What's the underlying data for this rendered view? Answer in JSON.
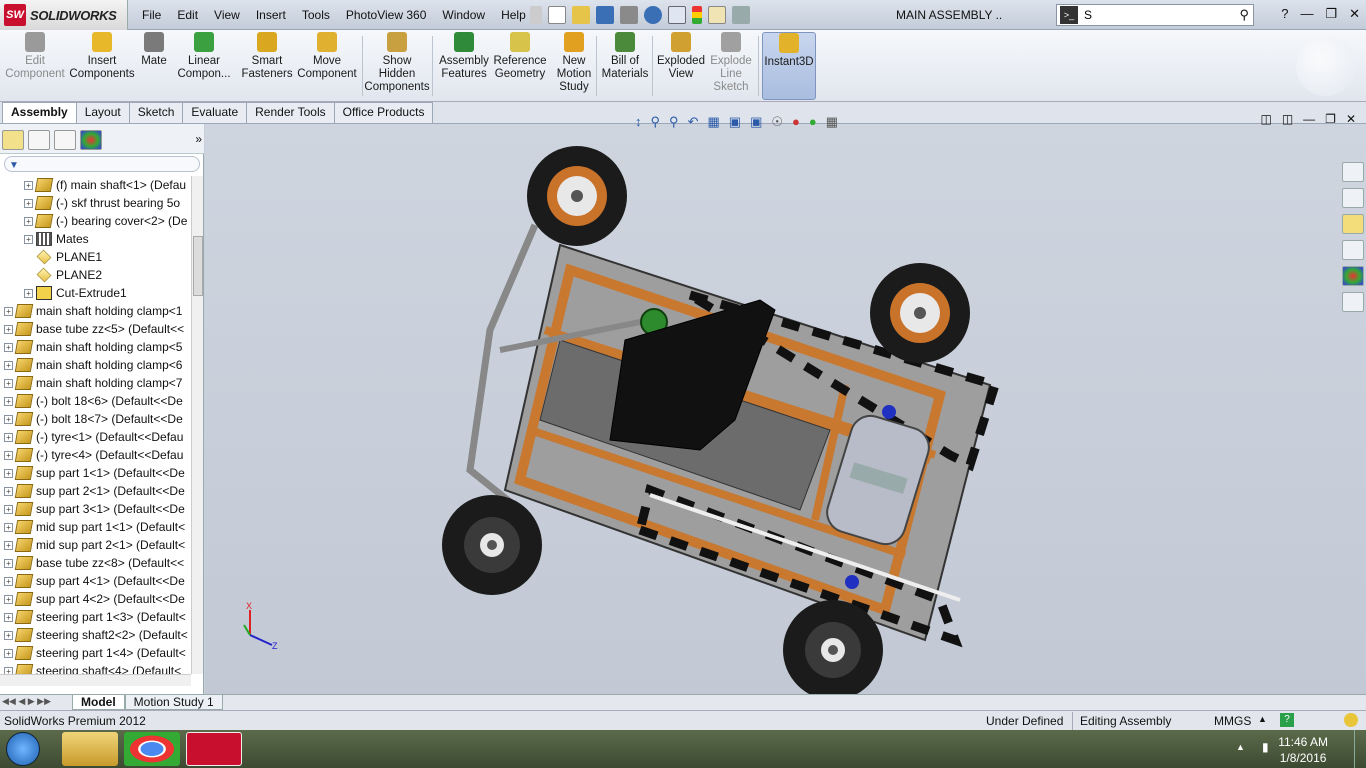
{
  "app": {
    "brand": "SOLIDWORKS",
    "brand_badge": "SW"
  },
  "menu": [
    "File",
    "Edit",
    "View",
    "Insert",
    "Tools",
    "PhotoView 360",
    "Window",
    "Help"
  ],
  "document_title": "MAIN ASSEMBLY ..",
  "search": {
    "value": "S",
    "cmd_icon": "command-prompt-icon"
  },
  "toolbar": [
    {
      "label": "Edit\nComponent",
      "icon": "edit-component-icon",
      "enabled": false,
      "color": "#9a9a9a"
    },
    {
      "label": "Insert\nComponents",
      "icon": "insert-components-icon",
      "enabled": true,
      "color": "#e6b82a"
    },
    {
      "label": "Mate",
      "icon": "mate-icon",
      "enabled": true,
      "color": "#7a7a7a"
    },
    {
      "label": "Linear\nCompon...",
      "icon": "linear-pattern-icon",
      "enabled": true,
      "color": "#3aa040"
    },
    {
      "label": "Smart\nFasteners",
      "icon": "smart-fasteners-icon",
      "enabled": true,
      "color": "#d9a820"
    },
    {
      "label": "Move\nComponent",
      "icon": "move-component-icon",
      "enabled": true,
      "color": "#e0b030"
    },
    {
      "label": "Show\nHidden\nComponents",
      "icon": "show-hidden-icon",
      "enabled": true,
      "color": "#c9a040"
    },
    {
      "label": "Assembly\nFeatures",
      "icon": "assembly-features-icon",
      "enabled": true,
      "color": "#2f8a3a"
    },
    {
      "label": "Reference\nGeometry",
      "icon": "reference-geometry-icon",
      "enabled": true,
      "color": "#d7c24a"
    },
    {
      "label": "New\nMotion\nStudy",
      "icon": "motion-study-icon",
      "enabled": true,
      "color": "#e2a020"
    },
    {
      "label": "Bill of\nMaterials",
      "icon": "bill-of-materials-icon",
      "enabled": true,
      "color": "#4a8a3a"
    },
    {
      "label": "Exploded\nView",
      "icon": "exploded-view-icon",
      "enabled": true,
      "color": "#d0a030"
    },
    {
      "label": "Explode\nLine\nSketch",
      "icon": "explode-line-sketch-icon",
      "enabled": false,
      "color": "#a0a0a0"
    },
    {
      "label": "Instant3D",
      "icon": "instant3d-icon",
      "enabled": true,
      "color": "#e2b22a"
    }
  ],
  "tabs": [
    "Assembly",
    "Layout",
    "Sketch",
    "Evaluate",
    "Render Tools",
    "Office Products"
  ],
  "tree": [
    {
      "label": "(f) main shaft<1> (Defau",
      "type": "part",
      "expander": "+",
      "indent": 1
    },
    {
      "label": "(-) skf thrust bearing 5o",
      "type": "part",
      "expander": "+",
      "indent": 1
    },
    {
      "label": "(-) bearing cover<2> (De",
      "type": "part",
      "expander": "+",
      "indent": 1
    },
    {
      "label": "Mates",
      "type": "mate",
      "expander": "+",
      "indent": 1
    },
    {
      "label": "PLANE1",
      "type": "plane",
      "expander": "",
      "indent": 1
    },
    {
      "label": "PLANE2",
      "type": "plane",
      "expander": "",
      "indent": 1
    },
    {
      "label": "Cut-Extrude1",
      "type": "feature",
      "expander": "+",
      "indent": 1
    },
    {
      "label": "main shaft holding clamp<1",
      "type": "part",
      "expander": "+",
      "indent": 0
    },
    {
      "label": "base tube zz<5> (Default<<",
      "type": "part",
      "expander": "+",
      "indent": 0
    },
    {
      "label": "main shaft holding clamp<5",
      "type": "part",
      "expander": "+",
      "indent": 0
    },
    {
      "label": "main shaft holding clamp<6",
      "type": "part",
      "expander": "+",
      "indent": 0
    },
    {
      "label": "main shaft holding clamp<7",
      "type": "part",
      "expander": "+",
      "indent": 0
    },
    {
      "label": "(-) bolt 18<6> (Default<<De",
      "type": "part",
      "expander": "+",
      "indent": 0
    },
    {
      "label": "(-) bolt 18<7> (Default<<De",
      "type": "part",
      "expander": "+",
      "indent": 0
    },
    {
      "label": "(-) tyre<1> (Default<<Defau",
      "type": "part",
      "expander": "+",
      "indent": 0
    },
    {
      "label": "(-) tyre<4> (Default<<Defau",
      "type": "part",
      "expander": "+",
      "indent": 0
    },
    {
      "label": "sup part 1<1> (Default<<De",
      "type": "part",
      "expander": "+",
      "indent": 0
    },
    {
      "label": "sup part 2<1> (Default<<De",
      "type": "part",
      "expander": "+",
      "indent": 0
    },
    {
      "label": "sup part 3<1> (Default<<De",
      "type": "part",
      "expander": "+",
      "indent": 0
    },
    {
      "label": "mid sup part 1<1> (Default<",
      "type": "part",
      "expander": "+",
      "indent": 0
    },
    {
      "label": "mid sup part 2<1> (Default<",
      "type": "part",
      "expander": "+",
      "indent": 0
    },
    {
      "label": "base tube zz<8> (Default<<",
      "type": "part",
      "expander": "+",
      "indent": 0
    },
    {
      "label": "sup part 4<1> (Default<<De",
      "type": "part",
      "expander": "+",
      "indent": 0
    },
    {
      "label": "sup part 4<2> (Default<<De",
      "type": "part",
      "expander": "+",
      "indent": 0
    },
    {
      "label": "steering part 1<3> (Default<",
      "type": "part",
      "expander": "+",
      "indent": 0
    },
    {
      "label": "steering shaft2<2> (Default<",
      "type": "part",
      "expander": "+",
      "indent": 0
    },
    {
      "label": "steering part 1<4> (Default<",
      "type": "part",
      "expander": "+",
      "indent": 0
    },
    {
      "label": "steering shaft<4> (Default<",
      "type": "part",
      "expander": "+",
      "indent": 0
    }
  ],
  "triad": {
    "x": "X",
    "z": "Z"
  },
  "bottom_tabs": [
    "Model",
    "Motion Study 1"
  ],
  "status": {
    "product": "SolidWorks Premium 2012",
    "definition": "Under Defined",
    "mode": "Editing Assembly",
    "units": "MMGS",
    "units_arrow": "▲",
    "help": "?"
  },
  "taskbar": {
    "time": "11:46 AM",
    "date": "1/8/2016"
  },
  "colors": {
    "frame": "#c8782f",
    "tire": "#1b1b1b",
    "rim_orange": "#c8722a",
    "seat": "#111111",
    "accent_green": "#2d8a2d"
  }
}
